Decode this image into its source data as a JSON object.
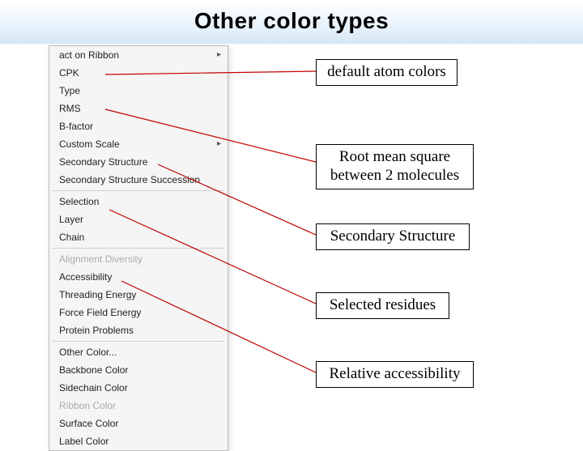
{
  "title": "Other color types",
  "menu": {
    "groups": [
      [
        {
          "label": "act on Ribbon",
          "sub": true
        },
        {
          "label": "CPK"
        },
        {
          "label": "Type"
        },
        {
          "label": "RMS"
        },
        {
          "label": "B-factor"
        },
        {
          "label": "Custom Scale",
          "sub": true
        },
        {
          "label": "Secondary Structure"
        },
        {
          "label": "Secondary Structure Succession"
        }
      ],
      [
        {
          "label": "Selection"
        },
        {
          "label": "Layer"
        },
        {
          "label": "Chain"
        }
      ],
      [
        {
          "label": "Alignment Diversity",
          "disabled": true
        },
        {
          "label": "Accessibility"
        },
        {
          "label": "Threading Energy"
        },
        {
          "label": "Force Field Energy"
        },
        {
          "label": "Protein Problems"
        }
      ],
      [
        {
          "label": "Other Color..."
        },
        {
          "label": "Backbone Color"
        },
        {
          "label": "Sidechain Color"
        },
        {
          "label": "Ribbon Color",
          "disabled": true
        },
        {
          "label": "Surface Color"
        },
        {
          "label": "Label Color"
        }
      ]
    ]
  },
  "callouts": [
    {
      "text": "default atom colors"
    },
    {
      "text": "Root mean square\nbetween 2 molecules"
    },
    {
      "text": "Secondary Structure"
    },
    {
      "text": "Selected residues"
    },
    {
      "text": "Relative accessibility"
    }
  ]
}
